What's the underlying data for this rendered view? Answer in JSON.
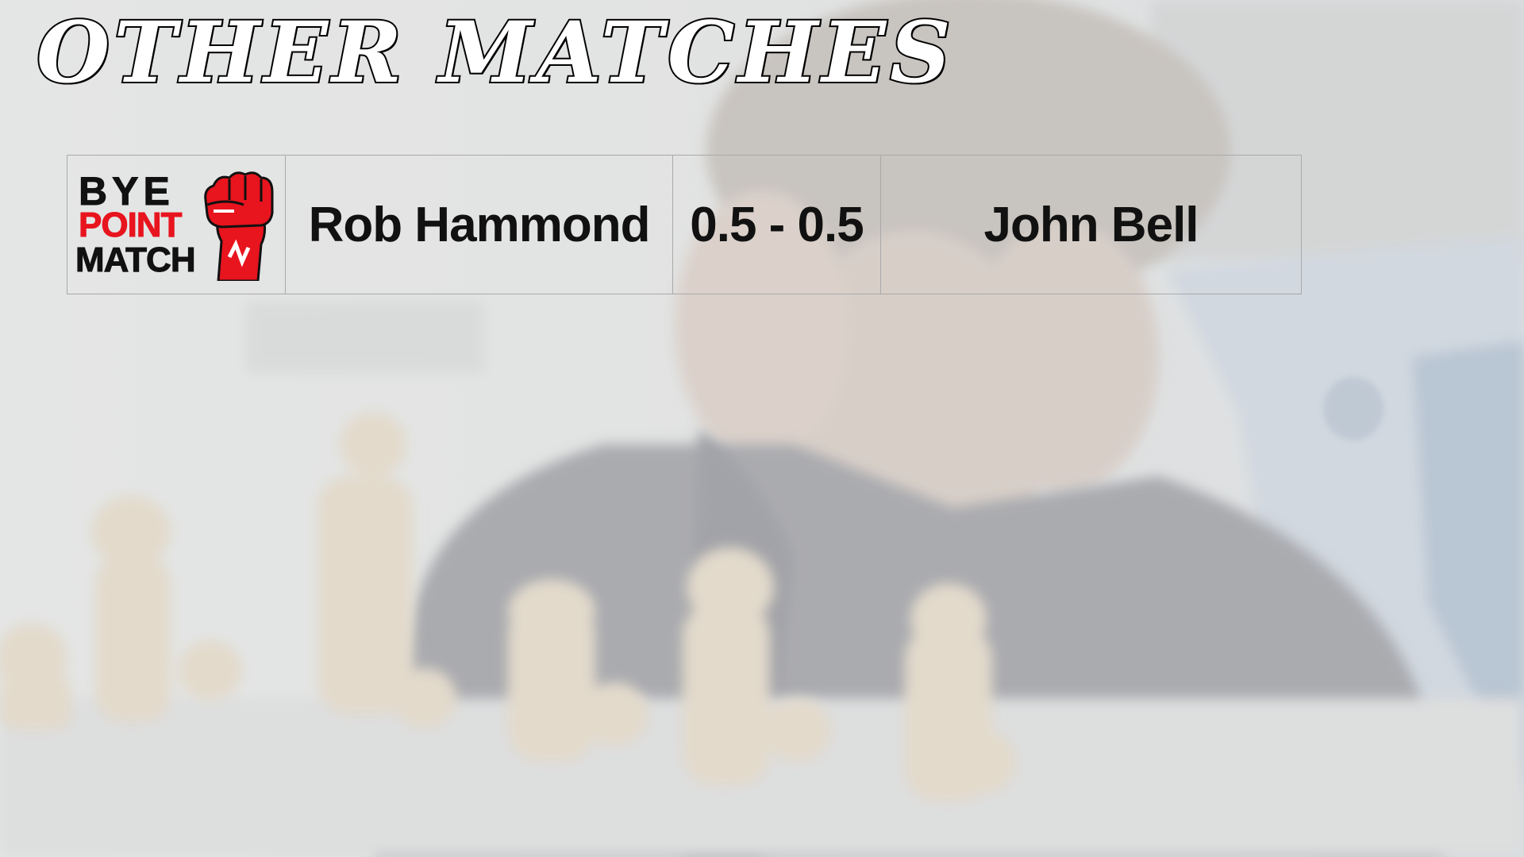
{
  "title": "OTHER MATCHES",
  "logo": {
    "line1": "BYE",
    "line2": "POINT",
    "line3": "MATCH",
    "colors": {
      "red": "#e8141e",
      "black": "#111111"
    },
    "icon": "raised-fist-icon"
  },
  "matches": [
    {
      "home": "Rob Hammond",
      "score": "0.5 - 0.5",
      "away": "John Bell"
    }
  ],
  "colors": {
    "background": "#d9dad9",
    "title_fill": "#ffffff",
    "title_stroke": "#000000",
    "table_border": "#a9a9a9",
    "text": "#111111"
  }
}
